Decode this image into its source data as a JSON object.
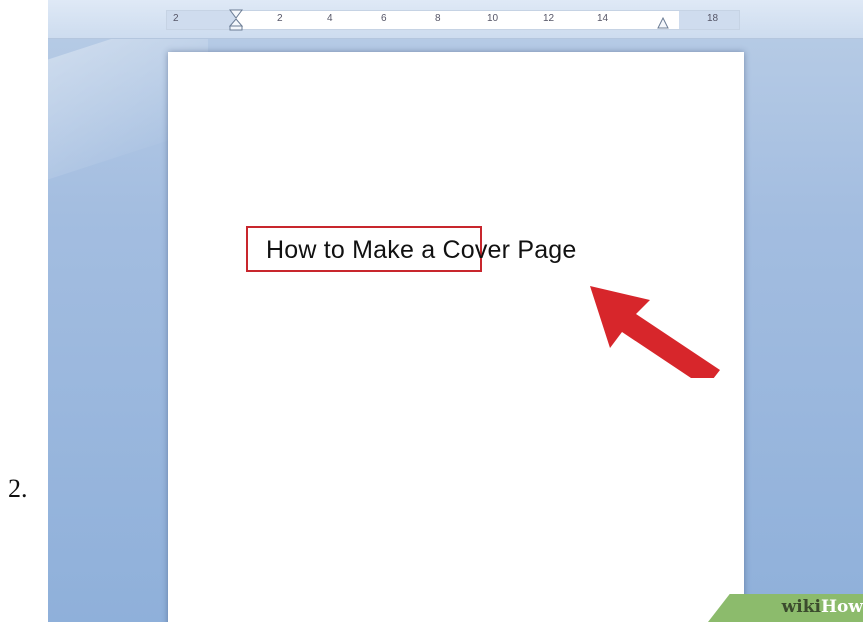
{
  "step": {
    "number": "2."
  },
  "ruler": {
    "ticks": [
      "2",
      "2",
      "4",
      "6",
      "8",
      "10",
      "12",
      "14",
      "18"
    ]
  },
  "document": {
    "title_text": "How to Make a Cover Page"
  },
  "watermark": {
    "brand_a": "wiki",
    "brand_b": "How"
  },
  "colors": {
    "highlight_border": "#c8262d",
    "arrow": "#d7262b",
    "workspace": "#a3bde0",
    "watermark_bg": "#8cbb6c"
  },
  "icons": [
    "first-line-indent-icon",
    "right-indent-icon",
    "pointer-arrow-icon"
  ]
}
